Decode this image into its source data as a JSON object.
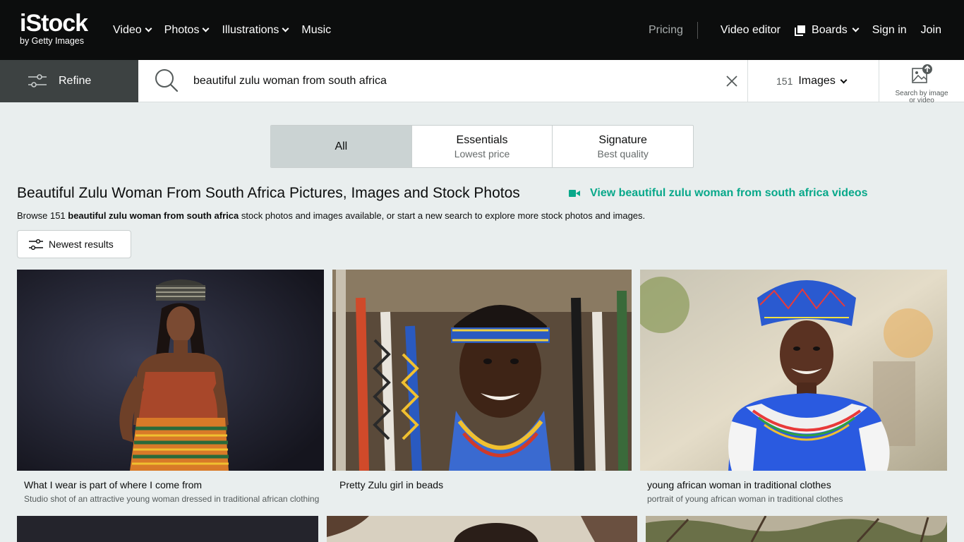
{
  "header": {
    "logo_main": "iStock",
    "logo_sub": "by Getty Images",
    "nav_left": [
      {
        "label": "Video",
        "has_menu": true
      },
      {
        "label": "Photos",
        "has_menu": true
      },
      {
        "label": "Illustrations",
        "has_menu": true
      },
      {
        "label": "Music",
        "has_menu": false
      }
    ],
    "pricing": "Pricing",
    "video_editor": "Video editor",
    "boards": "Boards",
    "sign_in": "Sign in",
    "join": "Join"
  },
  "search": {
    "refine_label": "Refine",
    "query": "beautiful zulu woman from south africa",
    "count": "151",
    "media_type": "Images",
    "search_by_image_line1": "Search by image",
    "search_by_image_line2": "or video"
  },
  "tabs": [
    {
      "title": "All",
      "sub": "",
      "active": true
    },
    {
      "title": "Essentials",
      "sub": "Lowest price",
      "active": false
    },
    {
      "title": "Signature",
      "sub": "Best quality",
      "active": false
    }
  ],
  "results": {
    "title": "Beautiful Zulu Woman From South Africa Pictures, Images and Stock Photos",
    "video_link": "View beautiful zulu woman from south africa videos",
    "browse_prefix": "Browse 151 ",
    "browse_bold": "beautiful zulu woman from south africa",
    "browse_suffix": " stock photos and images available, or start a new search to explore more stock photos and images.",
    "sort_label": "Newest results"
  },
  "images": [
    {
      "title": "What I wear is part of where I come from",
      "description": "Studio shot of an attractive young woman dressed in traditional african clothing"
    },
    {
      "title": "Pretty Zulu girl in beads",
      "description": ""
    },
    {
      "title": "young african woman in traditional clothes",
      "description": "portrait of young african woman in traditional clothes"
    }
  ],
  "colors": {
    "header_bg": "#0c0d0d",
    "page_bg": "#e9eeee",
    "accent_green": "#08a88a",
    "refine_bg": "#3d4242"
  }
}
